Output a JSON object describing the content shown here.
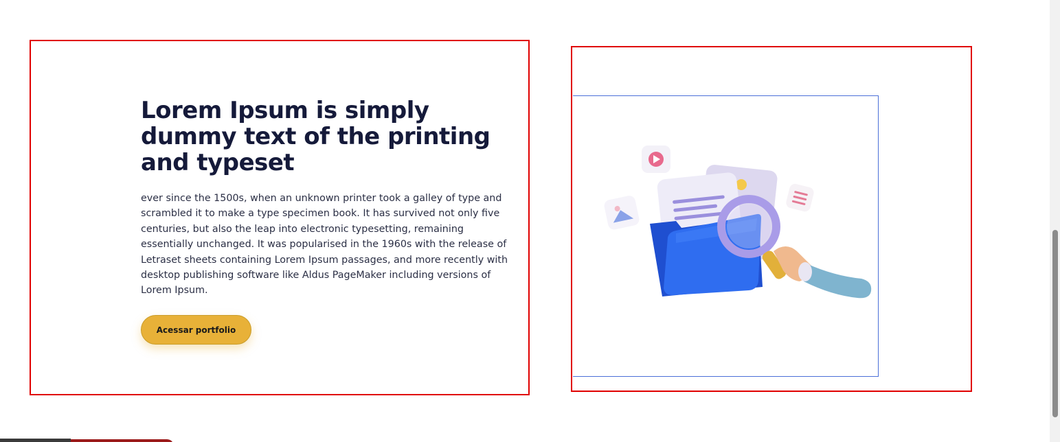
{
  "content": {
    "heading": "Lorem Ipsum is simply dummy text of the printing and typeset",
    "body": "ever since the 1500s, when an unknown printer took a galley of type and scrambled it to make a type specimen book. It has survived not only five centuries, but also the leap into electronic typesetting, remaining essentially unchanged. It was popularised in the 1960s with the release of Letraset sheets containing Lorem Ipsum passages, and more recently with desktop publishing software like Aldus PageMaker including versions of Lorem Ipsum.",
    "cta_label": "Acessar portfolio"
  },
  "illustration": {
    "icon": "folder-search-illustration"
  },
  "colors": {
    "outline": "#e00000",
    "heading": "#151a3a",
    "button": "#e8b138",
    "folder": "#2f6df0"
  }
}
